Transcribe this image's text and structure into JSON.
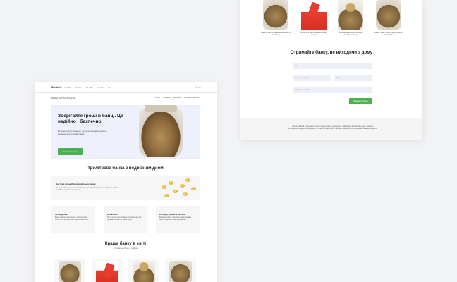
{
  "right_card": {
    "products": [
      {
        "caption": "Банк розмітий Ангарданов банку в Акторіаду",
        "img": "jar-coins"
      },
      {
        "caption": "Монети зі свята вальних банку джеку",
        "img": "red-piggy"
      },
      {
        "caption": "Розсадження Банку вигода заходити банку",
        "img": "coin-hand"
      },
      {
        "caption": "Банку банку для 1 Банку, грошей банку 300 л",
        "img": "jar-coins"
      }
    ],
    "form": {
      "title": "Отримайте банку, не виходячи з дому",
      "name_placeholder": "Ім'я",
      "phone_placeholder": "Номер телефону",
      "email_placeholder": "Email",
      "address_placeholder": "Адреса доставки",
      "submit_label": "Замовити банку"
    },
    "footer_text": "Банка Banka36 створена на той або існуючи місце розміщення. Інформація про активну сиру і можливе зобов'язання відвертає відповідно, та повністю відповідно. Сайт не є офертою, обов'язковими банками заходити."
  },
  "left_card": {
    "nav": {
      "logo_prefix": "Banka",
      "logo_suffix": "36",
      "links": [
        "Головна",
        "Магазин",
        "Про банку",
        "Контакти",
        "Блог"
      ],
      "lang": "UA / RU"
    },
    "subnav": {
      "title": "ВАША БАНКА У БАНЦІ",
      "links": [
        "Вибір",
        "Переваги",
        "Доставка",
        "Як Користуватися"
      ]
    },
    "hero": {
      "title": "Зберігайте гроші в банці. Це надійно і безпечно.",
      "text": "Ви можете бути впевнені, що гроші в надійному місці, захищені в трилітровій банці.",
      "button": "Замовити банку"
    },
    "section1_title": "Трилітрова банка з подвійним дном",
    "band": {
      "title": "Частина грошей проявляються на дні",
      "text": "Ви звикли бачити свої гроші в банці, через 5-10 хв дно стає видимим. Можна потрібні інструменти та гроші."
    },
    "features": [
      {
        "title": "Гроші удома",
        "text": "Банка тримає гроші вдома, у вас під рукою. Безпечне зберігання без банківських комісій."
      },
      {
        "title": "Без комісії",
        "text": "Не потрібно платити банку за зберігання, вся сума залишається у вашій банці."
      },
      {
        "title": "Коліфиуі тривалої безпеки",
        "text": "Банка витримує падіння та удари, надійне закриття кришки забезпечує захист."
      }
    ],
    "section2_title": "Краща банку в світі",
    "section2_sub": "Оптимальна банку в інформ",
    "products": [
      {
        "img": "jar-coins"
      },
      {
        "img": "red-piggy"
      },
      {
        "img": "coin-hand"
      },
      {
        "img": "jar-coins"
      }
    ]
  },
  "colors": {
    "accent": "#4caf50",
    "background": "#f2f3f5",
    "hero_bg": "#eef0fb",
    "field_bg": "#eef0f7"
  }
}
